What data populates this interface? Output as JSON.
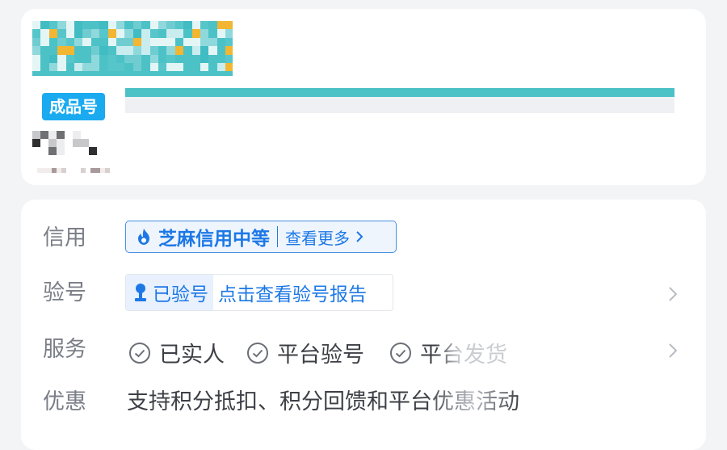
{
  "listing": {
    "tag": "成品号"
  },
  "details": {
    "credit": {
      "label": "信用",
      "level": "芝麻信用中等",
      "more": "查看更多",
      "colors": {
        "accent": "#1d78e6",
        "border": "#4a90e2",
        "background": "#eef5fd"
      },
      "icon": "flame-icon"
    },
    "verify": {
      "label": "验号",
      "status": "已验号",
      "report_link": "点击查看验号报告",
      "icon": "person-badge-icon"
    },
    "services": {
      "label": "服务",
      "items": [
        {
          "text": "已实人",
          "icon": "check-circle-icon"
        },
        {
          "text": "平台验号",
          "icon": "check-circle-icon"
        },
        {
          "text": "平台发货",
          "icon": "check-circle-icon"
        }
      ]
    },
    "promo": {
      "label": "优惠",
      "text": "支持积分抵扣、积分回馈和平台优惠活动"
    }
  },
  "colors": {
    "tag_background": "#1aaaf0",
    "title_bar": "#4cc2c7",
    "label_text": "#7a7e86",
    "body_text": "#3c3f45",
    "chevron": "#b8bcc4"
  }
}
